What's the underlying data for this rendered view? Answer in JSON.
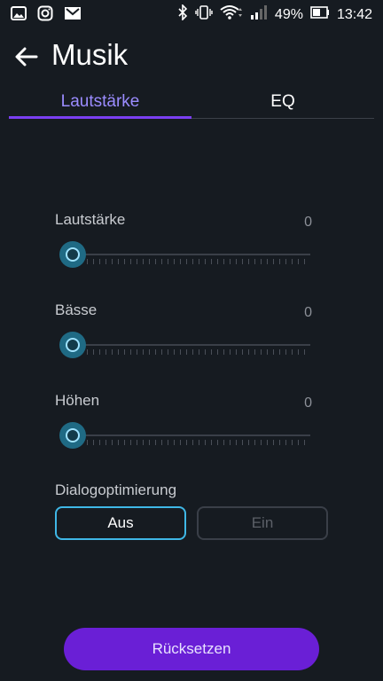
{
  "status_bar": {
    "battery_percent": "49%",
    "time": "13:42",
    "left_icons": [
      "gallery-icon",
      "instagram-icon",
      "mail-icon"
    ],
    "right_icons": [
      "bluetooth-icon",
      "vibrate-icon",
      "wifi-icon",
      "signal-icon",
      "battery-icon"
    ]
  },
  "header": {
    "title": "Musik",
    "back_icon": "arrow-left-icon"
  },
  "tabs": [
    {
      "label": "Lautstärke",
      "active": true
    },
    {
      "label": "EQ",
      "active": false
    }
  ],
  "sliders": [
    {
      "label": "Lautstärke",
      "value": "0"
    },
    {
      "label": "Bässe",
      "value": "0"
    },
    {
      "label": "Höhen",
      "value": "0"
    }
  ],
  "dialog": {
    "label": "Dialogoptimierung",
    "options": [
      {
        "label": "Aus",
        "selected": true
      },
      {
        "label": "Ein",
        "selected": false
      }
    ]
  },
  "reset_label": "Rücksetzen",
  "colors": {
    "background": "#161b21",
    "accent_purple": "#7a3ff2",
    "accent_cyan": "#3fb7e6",
    "button_purple": "#6a1fd6"
  }
}
